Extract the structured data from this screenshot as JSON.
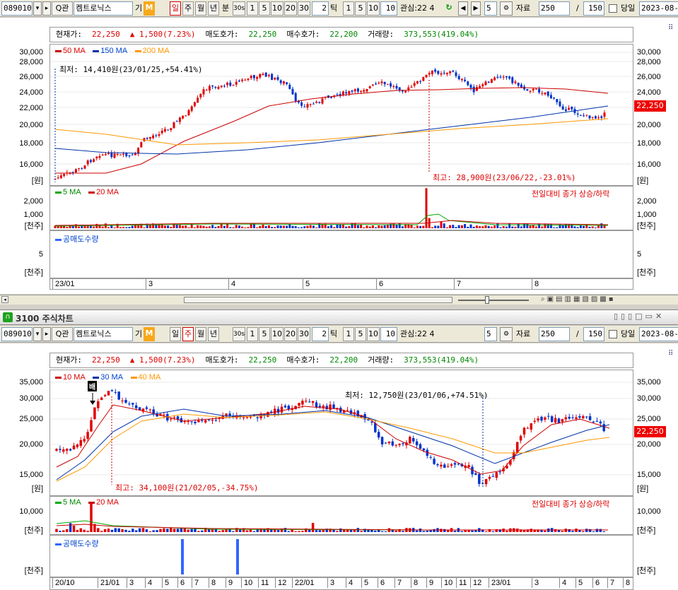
{
  "toolbar": {
    "code": "089010",
    "name": "켐트로닉스",
    "search_label": "Q관",
    "gi_label": "기",
    "m_label": "M",
    "periods": [
      "일",
      "주",
      "월",
      "년",
      "분",
      "30s",
      "1",
      "5",
      "10",
      "20",
      "30"
    ],
    "tick_value": "2",
    "tick_label": "틱",
    "tick_opts": [
      "1",
      "5",
      "10",
      "10"
    ],
    "interest_label": "관심:22 4",
    "count_value": "5",
    "data_label": "자료",
    "data_count": "250",
    "slash": "/",
    "total": "150",
    "same_day_label": "당일",
    "date": "2023-08-"
  },
  "window_title": "3100 주식차트",
  "info": {
    "price_label": "현재가:",
    "price": "22,250",
    "change": "▲ 1,500(7.23%)",
    "ask_label": "매도호가:",
    "ask": "22,250",
    "bid_label": "매수호가:",
    "bid": "22,200",
    "vol_label": "거래량:",
    "vol": "373,553(419.04%)"
  },
  "top": {
    "legend": [
      "50 MA",
      "150 MA",
      "200 MA"
    ],
    "legend_colors": [
      "#cc0000",
      "#0033aa",
      "#ff9900"
    ],
    "yticks": [
      "30,000",
      "28,000",
      "26,000",
      "24,000",
      "22,000",
      "20,000",
      "18,000",
      "16,000"
    ],
    "unit": "[원]",
    "low_ann": "최저: 14,410원(23/01/25,+54.41%)",
    "high_ann": "최고: 28,900원(23/06/22,-23.01%)",
    "cur_badge": "22,250",
    "vol_legend": [
      "5 MA",
      "20 MA"
    ],
    "vol_right": "전일대비 종가 상승/하락",
    "vol_ticks": [
      "2,000",
      "1,000"
    ],
    "vol_unit": "[천주]",
    "short_label": "공매도수량",
    "short_tick": "5",
    "short_unit": "[천주]",
    "xlabels": [
      "23/01",
      "3",
      "4",
      "5",
      "6",
      "7",
      "8"
    ]
  },
  "bottom": {
    "legend": [
      "10 MA",
      "30 MA",
      "40 MA"
    ],
    "legend_colors": [
      "#cc0000",
      "#0033aa",
      "#ff9900"
    ],
    "yticks": [
      "35,000",
      "30,000",
      "25,000",
      "20,000",
      "15,000"
    ],
    "unit": "[원]",
    "bae_label": "배",
    "low_ann": "최저: 12,750원(23/01/06,+74.51%)",
    "high_ann": "최고: 34,100원(21/02/05,-34.75%)",
    "cur_badge": "22,250",
    "vol_legend": [
      "5 MA",
      "20 MA"
    ],
    "vol_right": "전일대비 종가 상승/하락",
    "vol_ticks": [
      "10,000"
    ],
    "vol_unit": "[천주]",
    "short_label": "공매도수량",
    "short_unit": "[천주]",
    "xlabels": [
      "20/10",
      "21/01",
      "3",
      "4",
      "5",
      "6",
      "7",
      "8",
      "9",
      "10",
      "11",
      "12",
      "22/01",
      "3",
      "4",
      "5",
      "6",
      "7",
      "8",
      "9",
      "10",
      "11",
      "12",
      "23/01",
      "3",
      "4",
      "5",
      "6",
      "7",
      "8"
    ]
  },
  "colors": {
    "up": "#e00000",
    "down": "#0033cc",
    "ma_red": "#cc0000",
    "ma_blue": "#0033aa",
    "ma_orange": "#ff9900",
    "ma_green": "#00aa00"
  }
}
